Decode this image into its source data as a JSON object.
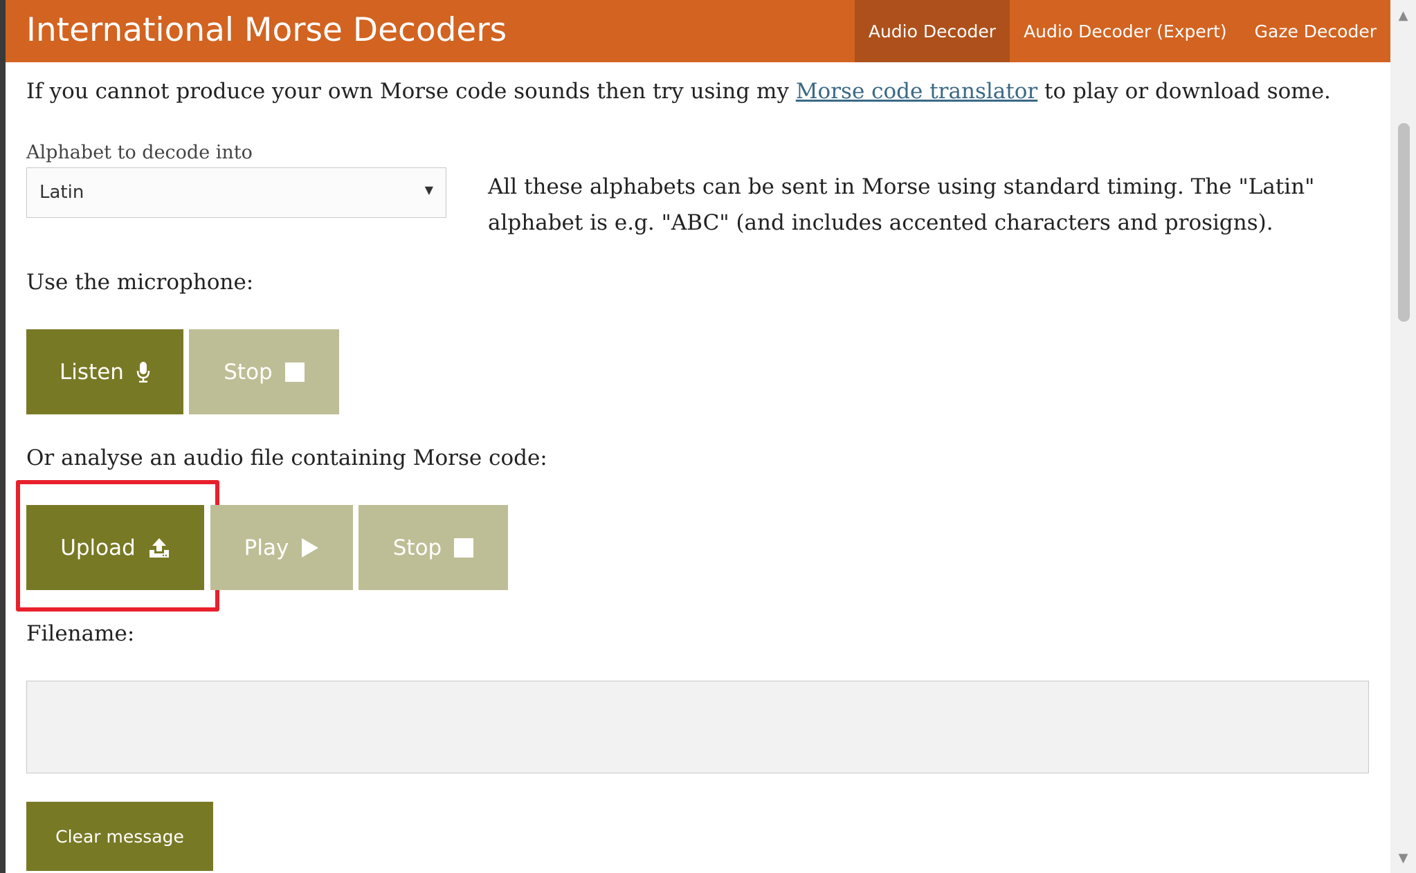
{
  "header": {
    "title": "International Morse Decoders",
    "nav": [
      {
        "label": "Audio Decoder",
        "active": true
      },
      {
        "label": "Audio Decoder (Expert)",
        "active": false
      },
      {
        "label": "Gaze Decoder",
        "active": false
      }
    ],
    "brand_color": "#d26321",
    "active_nav_color": "#ae501b"
  },
  "intro": {
    "before_link": "If you cannot produce your own Morse code sounds then try using my ",
    "link_text": "Morse code translator",
    "after_link": " to play or download some."
  },
  "alphabet": {
    "label": "Alphabet to decode into",
    "selected": "Latin",
    "note": "All these alphabets can be sent in Morse using standard timing. The \"Latin\" alphabet is e.g. \"ABC\" (and includes accented characters and prosigns)."
  },
  "microphone": {
    "label": "Use the microphone:",
    "listen_label": "Listen",
    "stop_label": "Stop"
  },
  "file": {
    "label": "Or analyse an audio file containing Morse code:",
    "upload_label": "Upload",
    "play_label": "Play",
    "stop_label": "Stop"
  },
  "filename": {
    "label": "Filename:",
    "value": ""
  },
  "clear_label": "Clear message",
  "colors": {
    "button_dark": "#787925",
    "button_light": "#bdbe95",
    "highlight": "#e8202b",
    "link": "#3a6986"
  },
  "icons": {
    "listen": "microphone-icon",
    "mic_stop": "stop-square-icon",
    "upload": "upload-icon",
    "play": "play-icon",
    "file_stop": "stop-square-icon",
    "select": "caret-down-icon",
    "scroll_up": "scroll-up-arrow-icon",
    "scroll_down": "scroll-down-arrow-icon"
  }
}
